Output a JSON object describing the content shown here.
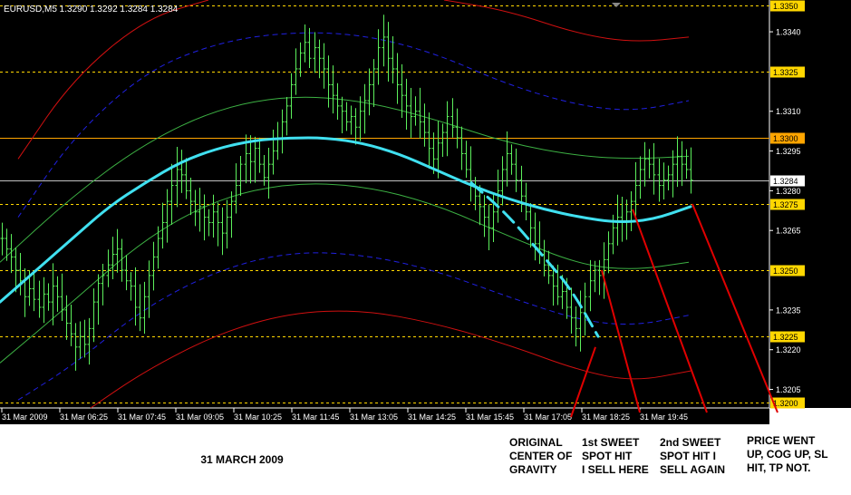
{
  "chart_data": {
    "type": "candlestick",
    "title": "EURUSD,M5  1.3290 1.3292 1.3284 1.3284",
    "caption": "31 MARCH 2009",
    "y_ticks": [
      {
        "value": 1.334,
        "label": "1.3340"
      },
      {
        "value": 1.331,
        "label": "1.3310"
      },
      {
        "value": 1.3295,
        "label": "1.3295"
      },
      {
        "value": 1.328,
        "label": "1.3280"
      },
      {
        "value": 1.3265,
        "label": "1.3265"
      },
      {
        "value": 1.3235,
        "label": "1.3235"
      },
      {
        "value": 1.322,
        "label": "1.3220"
      },
      {
        "value": 1.3205,
        "label": "1.3205"
      }
    ],
    "y_range": [
      1.3198,
      1.3352
    ],
    "x_ticks": [
      "31 Mar 2009",
      "31 Mar 06:25",
      "31 Mar 07:45",
      "31 Mar 09:05",
      "31 Mar 10:25",
      "31 Mar 11:45",
      "31 Mar 13:05",
      "31 Mar 14:25",
      "31 Mar 15:45",
      "31 Mar 17:05",
      "31 Mar 18:25",
      "31 Mar 19:45"
    ],
    "price_levels": [
      {
        "value": 1.335,
        "label": "1.3350",
        "style": "dashed",
        "color": "#ffd700"
      },
      {
        "value": 1.3325,
        "label": "1.3325",
        "style": "dashed",
        "color": "#ffd700"
      },
      {
        "value": 1.33,
        "label": "1.3300",
        "style": "solid",
        "color": "#ffa500"
      },
      {
        "value": 1.3284,
        "label": "1.3284",
        "style": "solid",
        "color": "#c0c0c0",
        "current": true
      },
      {
        "value": 1.3275,
        "label": "1.3275",
        "style": "dashed",
        "color": "#ffd700"
      },
      {
        "value": 1.325,
        "label": "1.3250",
        "style": "dashed",
        "color": "#ffd700"
      },
      {
        "value": 1.3225,
        "label": "1.3225",
        "style": "dashed",
        "color": "#ffd700"
      },
      {
        "value": 1.32,
        "label": "1.3200",
        "style": "dashed",
        "color": "#ffd700"
      }
    ],
    "series": [
      {
        "name": "",
        "role": "center-of-gravity",
        "color": "#40e0f0",
        "width": 3,
        "x": [
          0,
          40,
          80,
          120,
          160,
          200,
          240,
          280,
          320,
          360,
          400,
          440,
          480,
          520,
          560,
          600,
          640,
          680,
          720,
          762
        ],
        "y": [
          1.3238,
          1.325,
          1.3262,
          1.3274,
          1.3283,
          1.3291,
          1.3296,
          1.3299,
          1.33,
          1.33,
          1.3298,
          1.3294,
          1.3288,
          1.3282,
          1.3277,
          1.3273,
          1.327,
          1.3268,
          1.3269,
          1.3274
        ]
      },
      {
        "name": "",
        "role": "original-center-of-gravity",
        "color": "#40e0f0",
        "width": 3,
        "dashed": true,
        "x": [
          520,
          560,
          600,
          630,
          660
        ],
        "y": [
          1.3283,
          1.3271,
          1.3255,
          1.3243,
          1.3225
        ]
      },
      {
        "name": "",
        "role": "upper-band-1",
        "color": "#3cb043",
        "width": 1,
        "x": [
          0,
          80,
          160,
          240,
          320,
          400,
          480,
          560,
          640,
          700,
          760
        ],
        "y": [
          1.3253,
          1.3278,
          1.3298,
          1.3311,
          1.3316,
          1.3314,
          1.3307,
          1.3298,
          1.3293,
          1.3292,
          1.3293
        ]
      },
      {
        "name": "",
        "role": "lower-band-1",
        "color": "#3cb043",
        "width": 1,
        "x": [
          0,
          80,
          160,
          240,
          320,
          400,
          480,
          560,
          640,
          700,
          760
        ],
        "y": [
          1.3215,
          1.3238,
          1.3262,
          1.3277,
          1.3283,
          1.3282,
          1.3275,
          1.3263,
          1.3252,
          1.325,
          1.3253
        ]
      },
      {
        "name": "",
        "role": "upper-band-2",
        "color": "#2020e0",
        "width": 1,
        "dashed": true,
        "x": [
          20,
          80,
          160,
          240,
          320,
          400,
          480,
          560,
          640,
          700,
          760
        ],
        "y": [
          1.327,
          1.33,
          1.3325,
          1.3336,
          1.334,
          1.3339,
          1.3332,
          1.332,
          1.3312,
          1.331,
          1.3314
        ]
      },
      {
        "name": "",
        "role": "lower-band-2",
        "color": "#2020e0",
        "width": 1,
        "dashed": true,
        "x": [
          20,
          80,
          160,
          240,
          320,
          400,
          480,
          560,
          640,
          700,
          760
        ],
        "y": [
          1.3201,
          1.3214,
          1.3236,
          1.325,
          1.3257,
          1.3256,
          1.325,
          1.324,
          1.3231,
          1.3229,
          1.3233
        ]
      },
      {
        "name": "",
        "role": "upper-band-3",
        "color": "#d01010",
        "width": 1,
        "x": [
          20,
          80,
          160,
          230
        ],
        "y": [
          1.3292,
          1.3322,
          1.3345,
          1.3352
        ]
      },
      {
        "name": "",
        "role": "upper-band-3b",
        "color": "#d01010",
        "width": 1,
        "x": [
          490,
          560,
          640,
          700,
          760
        ],
        "y": [
          1.3352,
          1.3348,
          1.3339,
          1.3336,
          1.3338
        ]
      },
      {
        "name": "",
        "role": "lower-band-3",
        "color": "#d01010",
        "width": 1,
        "x": [
          100,
          160,
          240,
          320,
          400,
          480,
          560,
          640,
          700,
          762
        ],
        "y": [
          1.3198,
          1.3212,
          1.3226,
          1.3234,
          1.3235,
          1.323,
          1.3222,
          1.3212,
          1.3208,
          1.3212
        ]
      }
    ],
    "candles_close": [
      1.3262,
      1.3258,
      1.3255,
      1.325,
      1.3246,
      1.324,
      1.3243,
      1.3239,
      1.3236,
      1.3241,
      1.3238,
      1.3244,
      1.324,
      1.3235,
      1.323,
      1.3226,
      1.3221,
      1.3225,
      1.3222,
      1.3228,
      1.3238,
      1.3245,
      1.3248,
      1.3252,
      1.3256,
      1.3258,
      1.325,
      1.3246,
      1.3244,
      1.3236,
      1.3232,
      1.324,
      1.3248,
      1.3255,
      1.3262,
      1.3268,
      1.3276,
      1.3282,
      1.3288,
      1.3286,
      1.328,
      1.3276,
      1.3272,
      1.3274,
      1.327,
      1.3268,
      1.3272,
      1.3268,
      1.3264,
      1.327,
      1.3276,
      1.3282,
      1.329,
      1.3294,
      1.3291,
      1.3296,
      1.329,
      1.3285,
      1.329,
      1.3295,
      1.33,
      1.3306,
      1.3312,
      1.332,
      1.3326,
      1.3332,
      1.3336,
      1.333,
      1.3334,
      1.333,
      1.3326,
      1.332,
      1.3316,
      1.3312,
      1.331,
      1.3306,
      1.3308,
      1.3304,
      1.331,
      1.3314,
      1.332,
      1.3326,
      1.3334,
      1.3338,
      1.333,
      1.3326,
      1.332,
      1.3316,
      1.3312,
      1.3308,
      1.331,
      1.3306,
      1.3302,
      1.3296,
      1.3292,
      1.3298,
      1.3302,
      1.3308,
      1.3304,
      1.33,
      1.3294,
      1.3288,
      1.3282,
      1.3278,
      1.3274,
      1.327,
      1.3266,
      1.3272,
      1.328,
      1.3288,
      1.3294,
      1.329,
      1.3284,
      1.3278,
      1.3272,
      1.3266,
      1.326,
      1.3256,
      1.3252,
      1.3248,
      1.3244,
      1.324,
      1.3242,
      1.3236,
      1.3232,
      1.3228,
      1.3234,
      1.324,
      1.3246,
      1.325,
      1.3248,
      1.3254,
      1.326,
      1.3266,
      1.327,
      1.3268,
      1.3272,
      1.3276,
      1.3282,
      1.3288,
      1.3292,
      1.329,
      1.3286,
      1.3282,
      1.3284,
      1.3286,
      1.329,
      1.3293,
      1.329,
      1.3288,
      1.3284
    ],
    "annotations": [
      {
        "label": "ORIGINAL\nCENTER OF\nGRAVITY",
        "text_x": 562,
        "target_x": 657,
        "target_y": 1.3221
      },
      {
        "label": "1st SWEET\nSPOT HIT\nI SELL HERE",
        "text_x": 642,
        "target_x": 664,
        "target_y": 1.325
      },
      {
        "label": "2nd SWEET\nSPOT HIT I\nSELL AGAIN",
        "text_x": 728,
        "target_x": 698,
        "target_y": 1.3273
      },
      {
        "label": "PRICE WENT\nUP, COG UP, SL\nHIT, TP NOT.",
        "text_x": 824,
        "target_x": 764,
        "target_y": 1.3275
      }
    ]
  }
}
